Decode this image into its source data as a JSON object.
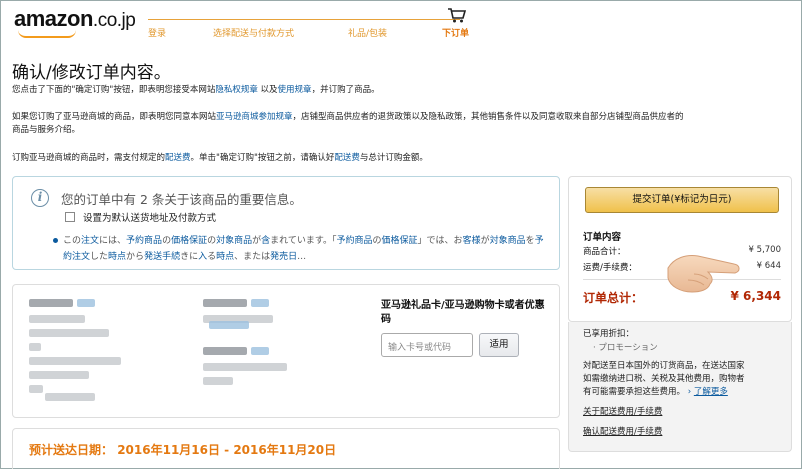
{
  "header": {
    "logo_text": "amazon",
    "logo_suffix": ".co.jp",
    "steps": [
      {
        "label": "登录",
        "active": false
      },
      {
        "label": "选择配送与付款方式",
        "active": false
      },
      {
        "label": "礼品/包装",
        "active": false
      },
      {
        "label": "下订单",
        "active": true
      }
    ]
  },
  "page": {
    "title": "确认/修改订单内容。",
    "intro": {
      "pre": "您点击了下面的\"确定订购\"按钮，即表明您接受本网站",
      "privacy": "隐私权规章",
      "mid": " 以及",
      "terms": "使用规章",
      "post": "，并订购了商品。"
    },
    "marketplace": {
      "pre": "如果您订购了亚马逊商城的商品，即表明您同意本网站",
      "link": "亚马逊商城参加规章",
      "line1_post": "，店铺型商品供应者的退货政策以及隐私政策，其他销售条件以及同意收取来自部分店铺型商品供应者的",
      "line2": "商品与服务介绍。"
    },
    "shipping_fee": {
      "pre": "订购亚马逊商城的商品时，需支付规定的",
      "link1": "配送费",
      "mid": "。单击\"确定订购\"按钮之前，请确认好",
      "link2": "配送费",
      "post": "与总计订购金额。"
    }
  },
  "infobox": {
    "title": "您的订单中有 2 条关于该商品的重要信息。",
    "checkbox_label": "设置为默认送货地址及付款方式",
    "notice": [
      {
        "t": "この",
        "l": false
      },
      {
        "t": "注文",
        "l": true
      },
      {
        "t": "には、",
        "l": false
      },
      {
        "t": "予約商品",
        "l": true
      },
      {
        "t": "の",
        "l": false
      },
      {
        "t": "価格保証",
        "l": true
      },
      {
        "t": "の",
        "l": false
      },
      {
        "t": "対象商品",
        "l": true
      },
      {
        "t": "が",
        "l": false
      },
      {
        "t": "含",
        "l": true
      },
      {
        "t": "まれています。「",
        "l": false
      },
      {
        "t": "予約商品",
        "l": true
      },
      {
        "t": "の",
        "l": false
      },
      {
        "t": "価格保証",
        "l": true
      },
      {
        "t": "」では、お",
        "l": false
      },
      {
        "t": "客様",
        "l": true
      },
      {
        "t": "が",
        "l": false
      },
      {
        "t": "対象商品",
        "l": true
      },
      {
        "t": "を",
        "l": false
      },
      {
        "t": "予約注文",
        "l": true
      },
      {
        "t": "した",
        "l": false
      },
      {
        "t": "時点",
        "l": true
      },
      {
        "t": "から",
        "l": false
      },
      {
        "t": "発送手続",
        "l": true
      },
      {
        "t": "きに",
        "l": false
      },
      {
        "t": "入",
        "l": true
      },
      {
        "t": "る",
        "l": false
      },
      {
        "t": "時点",
        "l": true
      },
      {
        "t": "、または",
        "l": false
      },
      {
        "t": "発売日",
        "l": true
      },
      {
        "t": "…",
        "l": false
      }
    ]
  },
  "gift": {
    "title": "亚马逊礼品卡/亚马逊购物卡或者优惠码",
    "placeholder": "输入卡号或代码",
    "apply_label": "适用"
  },
  "delivery": {
    "label": "预计送达日期：",
    "range": "2016年11月16日 - 2016年11月20日"
  },
  "summary": {
    "submit_label": "提交订单(¥标记为日元)",
    "heading": "订单内容",
    "rows": [
      {
        "label": "商品合计：",
        "value": "¥ 5,700"
      },
      {
        "label": "运费/手续费：",
        "value": "¥ 644"
      }
    ],
    "total_label": "订单总计：",
    "total_value": "¥ 6,344",
    "discount_label": "已享用折扣：",
    "promotion": "プロモーション",
    "import_note": [
      "対配送至日本国外的订货商品，在送达国家",
      "如需缴纳进口税、关税及其他费用，购物者",
      "有可能需要承担这些费用。"
    ],
    "learn_more": "了解更多",
    "link_shipping": "关于配送费用/手续费",
    "link_confirm": "确认配送费用/手续费"
  },
  "colors": {
    "accent_orange": "#e47911",
    "link_blue": "#0b5a9e",
    "price_red": "#b12704",
    "button_yellow": "#f0c14b"
  }
}
